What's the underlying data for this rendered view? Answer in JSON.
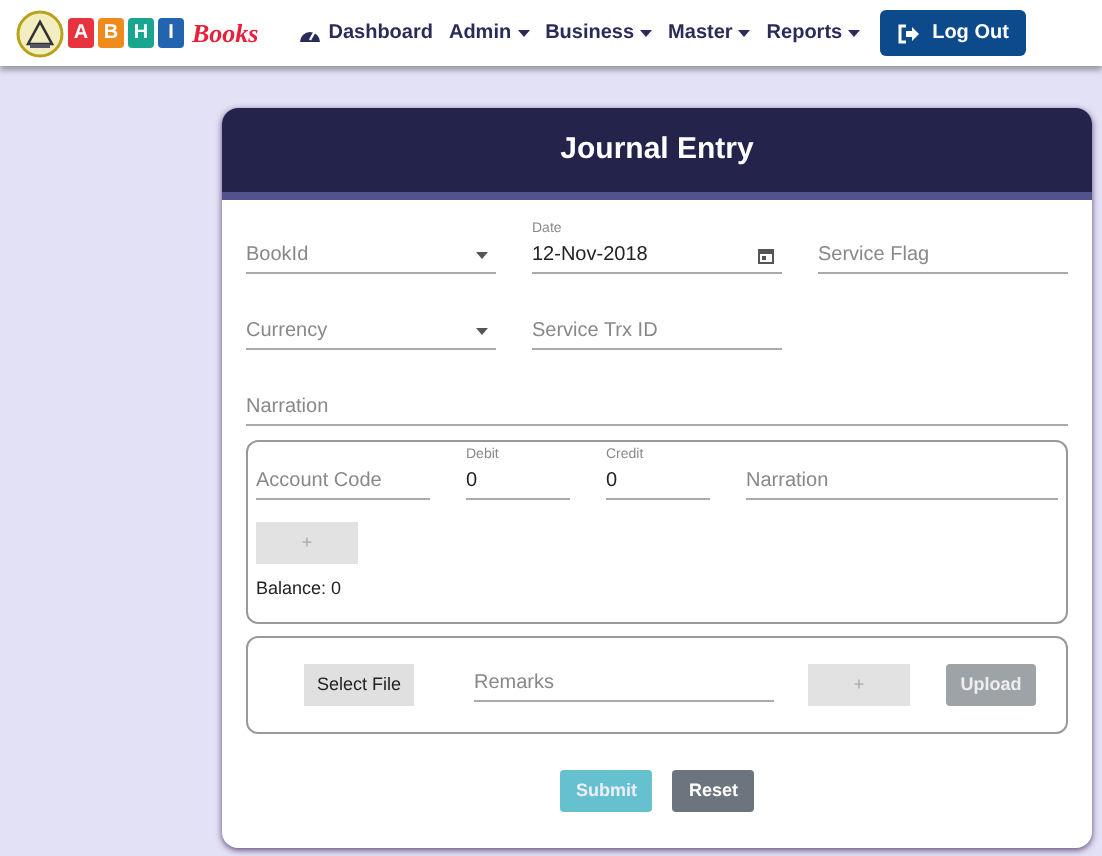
{
  "navbar": {
    "logo": {
      "letters": [
        "A",
        "B",
        "H",
        "I"
      ],
      "word": "Books"
    },
    "items": [
      {
        "label": "Dashboard",
        "kind": "link"
      },
      {
        "label": "Admin",
        "kind": "dropdown"
      },
      {
        "label": "Business",
        "kind": "dropdown"
      },
      {
        "label": "Master",
        "kind": "dropdown"
      },
      {
        "label": "Reports",
        "kind": "dropdown"
      }
    ],
    "logout": "Log Out"
  },
  "card": {
    "title": "Journal Entry",
    "fields": [
      {
        "placeholder": "BookId",
        "kind": "select"
      },
      {
        "label": "Date",
        "value": "12-Nov-2018",
        "kind": "date"
      },
      {
        "placeholder": "Service Flag",
        "kind": "text"
      },
      {
        "placeholder": "Currency",
        "kind": "select"
      },
      {
        "placeholder": "Service Trx ID",
        "kind": "text"
      }
    ],
    "narration": {
      "placeholder": "Narration"
    },
    "entry": {
      "account_code": {
        "placeholder": "Account Code"
      },
      "debit": {
        "label": "Debit",
        "value": "0"
      },
      "credit": {
        "label": "Credit",
        "value": "0"
      },
      "narration": {
        "placeholder": "Narration"
      },
      "add_button": {
        "label": "+",
        "disabled": true
      },
      "balance": "Balance: 0"
    },
    "attachment": {
      "select_file": "Select File",
      "remarks": {
        "placeholder": "Remarks"
      },
      "add_button": {
        "label": "+",
        "disabled": true
      },
      "upload_button": {
        "label": "Upload",
        "disabled": true
      }
    },
    "actions": [
      {
        "label": "Submit",
        "kind": "primary",
        "disabled": true
      },
      {
        "label": "Reset",
        "kind": "secondary",
        "disabled": false
      }
    ]
  }
}
